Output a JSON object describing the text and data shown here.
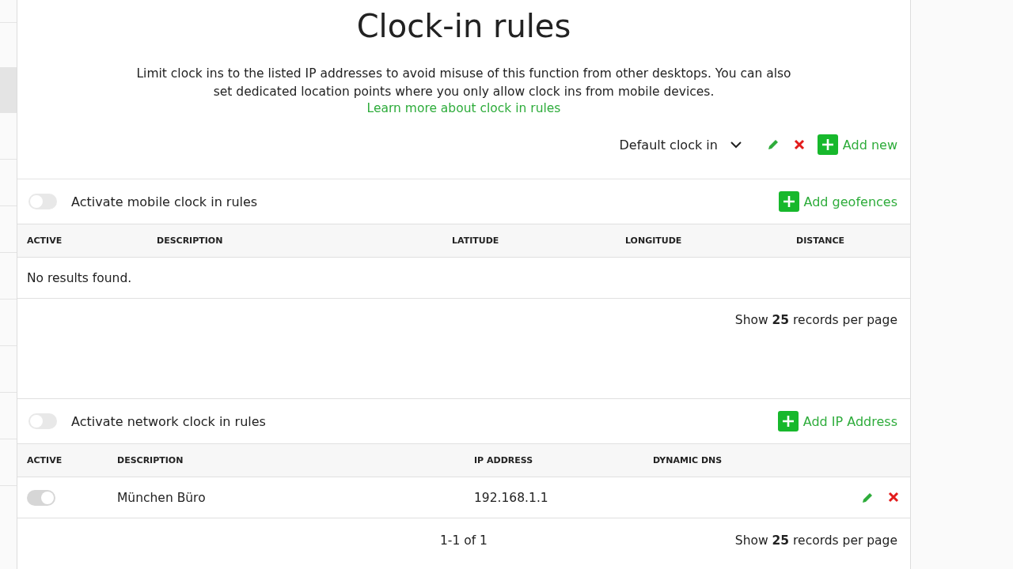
{
  "title": "Clock-in rules",
  "intro": "Limit clock ins to the listed IP addresses to avoid misuse of this function from other desktops. You can also set dedicated location points where you only allow clock ins from mobile devices.",
  "learn_more": "Learn more about clock in rules",
  "profile_select": {
    "value": "Default clock in"
  },
  "add_new": "Add new",
  "sections": [
    {
      "toggle_label": "Activate mobile clock in rules",
      "on": false,
      "add_label": "Add geofences",
      "columns": [
        "ACTIVE",
        "DESCRIPTION",
        "LATITUDE",
        "LONGITUDE",
        "DISTANCE"
      ],
      "empty_text": "No results found.",
      "per_page": "Show **25** records per page"
    },
    {
      "toggle_label": "Activate network clock in rules",
      "on": false,
      "add_label": "Add IP Address",
      "columns": [
        "ACTIVE",
        "DESCRIPTION",
        "IP ADDRESS",
        "DYNAMIC DNS"
      ],
      "rows": [
        {
          "on": true,
          "cells": [
            "",
            "München Büro",
            "192.168.1.1",
            ""
          ]
        }
      ],
      "pager": "1-1 of 1",
      "per_page": "Show **25** records per page"
    }
  ]
}
